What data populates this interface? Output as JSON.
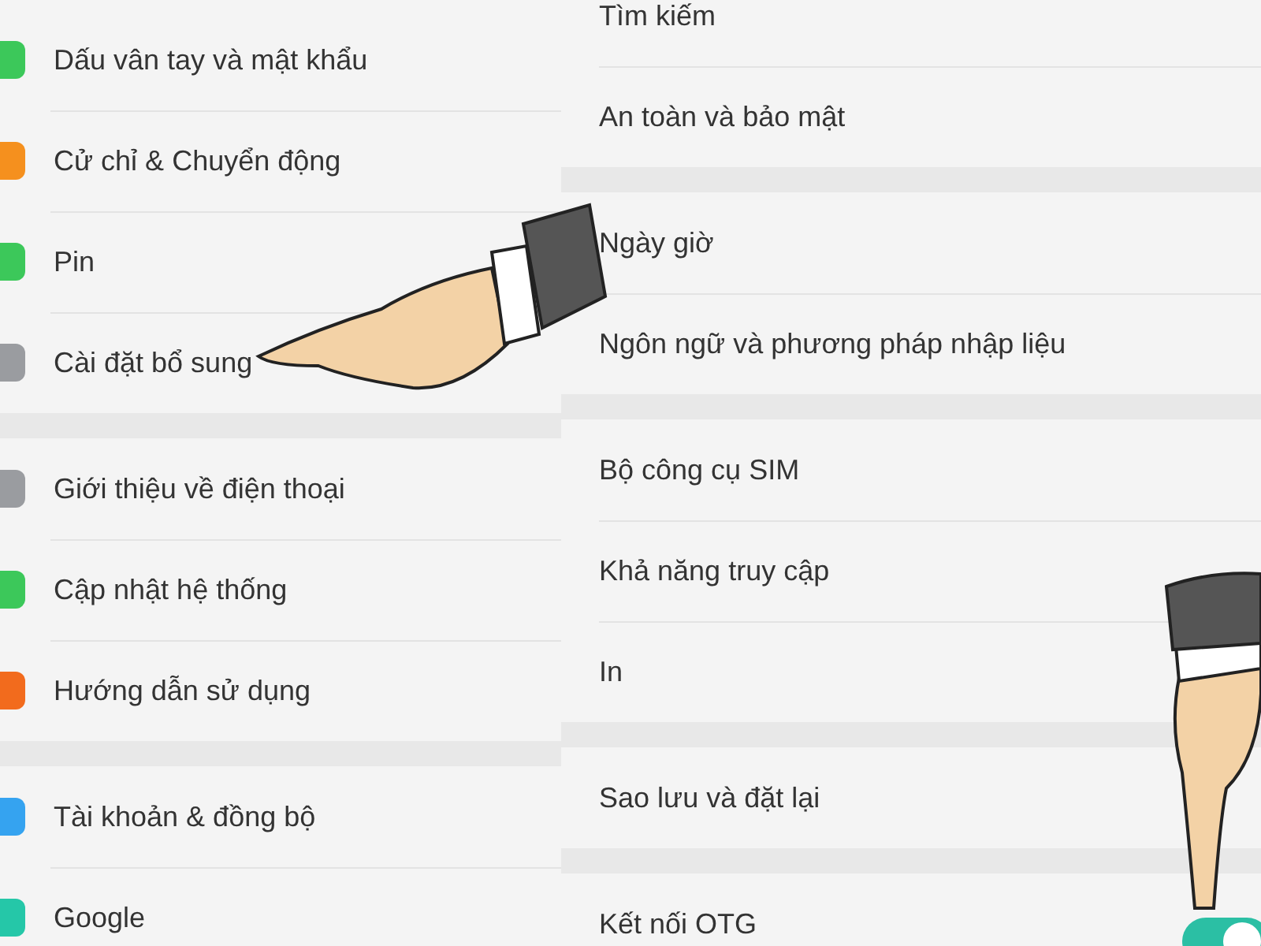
{
  "left_panel": {
    "sections": [
      {
        "items": [
          {
            "label": "Dấu vân tay và mật khẩu",
            "color": "#3cc85a"
          },
          {
            "label": "Cử chỉ & Chuyển động",
            "color": "#f5901e"
          },
          {
            "label": "Pin",
            "color": "#3cc85a"
          },
          {
            "label": "Cài đặt bổ sung",
            "color": "#9a9ca0"
          }
        ]
      },
      {
        "items": [
          {
            "label": "Giới thiệu về điện thoại",
            "color": "#9a9ca0"
          },
          {
            "label": "Cập nhật hệ thống",
            "color": "#3cc85a"
          },
          {
            "label": "Hướng dẫn sử dụng",
            "color": "#f26b1d"
          }
        ]
      },
      {
        "items": [
          {
            "label": "Tài khoản & đồng bộ",
            "color": "#35a3f0"
          },
          {
            "label": "Google",
            "color": "#25c7a8"
          }
        ]
      }
    ]
  },
  "right_panel": {
    "sections": [
      {
        "items": [
          {
            "label": "Tìm kiếm",
            "kind": "link"
          },
          {
            "label": "An toàn và bảo mật",
            "kind": "link"
          }
        ]
      },
      {
        "items": [
          {
            "label": "Ngày giờ",
            "kind": "link"
          },
          {
            "label": "Ngôn ngữ và phương pháp nhập liệu",
            "kind": "link"
          }
        ]
      },
      {
        "items": [
          {
            "label": "Bộ công cụ SIM",
            "kind": "link"
          },
          {
            "label": "Khả năng truy cập",
            "kind": "link"
          },
          {
            "label": "In",
            "kind": "link"
          }
        ]
      },
      {
        "items": [
          {
            "label": "Sao lưu và đặt lại",
            "kind": "link"
          }
        ]
      },
      {
        "items": [
          {
            "label": "Kết nối OTG",
            "kind": "toggle",
            "on": true
          }
        ]
      }
    ]
  }
}
